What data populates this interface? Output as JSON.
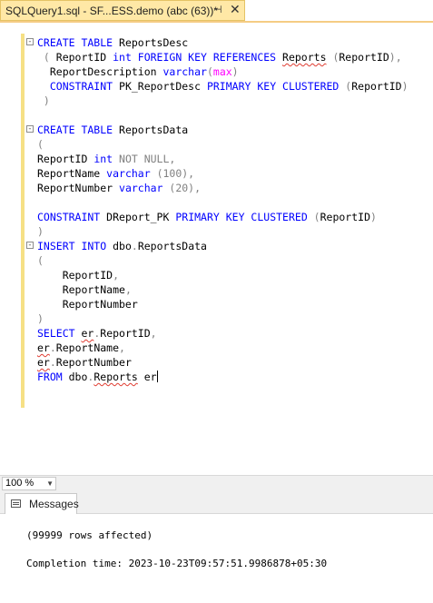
{
  "tab": {
    "title": "SQLQuery1.sql - SF...ESS.demo (abc (63))*",
    "pin_icon": "pin-icon",
    "close_icon": "close-icon"
  },
  "editor": {
    "lines": [
      {
        "fold": "-",
        "tokens": [
          {
            "t": "CREATE TABLE ",
            "c": "kw"
          },
          {
            "t": "ReportsDesc",
            "c": "id"
          }
        ]
      },
      {
        "tokens": [
          {
            "t": " ( ",
            "c": "gray"
          },
          {
            "t": "ReportID ",
            "c": "id"
          },
          {
            "t": "int FOREIGN KEY REFERENCES ",
            "c": "kw"
          },
          {
            "t": "Reports",
            "c": "wavy"
          },
          {
            "t": " ",
            "c": "id"
          },
          {
            "t": "(",
            "c": "gray"
          },
          {
            "t": "ReportID",
            "c": "id"
          },
          {
            "t": "),",
            "c": "gray"
          }
        ]
      },
      {
        "tokens": [
          {
            "t": "  ReportDescription ",
            "c": "id"
          },
          {
            "t": "varchar",
            "c": "kw"
          },
          {
            "t": "(",
            "c": "gray"
          },
          {
            "t": "max",
            "c": "fn"
          },
          {
            "t": ")",
            "c": "gray"
          }
        ]
      },
      {
        "tokens": [
          {
            "t": "  CONSTRAINT ",
            "c": "kw"
          },
          {
            "t": "PK_ReportDesc ",
            "c": "id"
          },
          {
            "t": "PRIMARY KEY CLUSTERED ",
            "c": "kw"
          },
          {
            "t": "(",
            "c": "gray"
          },
          {
            "t": "ReportID",
            "c": "id"
          },
          {
            "t": ")",
            "c": "gray"
          }
        ]
      },
      {
        "tokens": [
          {
            "t": " )",
            "c": "gray"
          }
        ]
      },
      {
        "tokens": []
      },
      {
        "fold": "-",
        "tokens": [
          {
            "t": "CREATE TABLE ",
            "c": "kw"
          },
          {
            "t": "ReportsData",
            "c": "id"
          }
        ]
      },
      {
        "tokens": [
          {
            "t": "(",
            "c": "gray"
          }
        ]
      },
      {
        "tokens": [
          {
            "t": "ReportID ",
            "c": "id"
          },
          {
            "t": "int ",
            "c": "kw"
          },
          {
            "t": "NOT NULL,",
            "c": "gray"
          }
        ]
      },
      {
        "tokens": [
          {
            "t": "ReportName ",
            "c": "id"
          },
          {
            "t": "varchar ",
            "c": "kw"
          },
          {
            "t": "(100),",
            "c": "gray"
          }
        ]
      },
      {
        "tokens": [
          {
            "t": "ReportNumber ",
            "c": "id"
          },
          {
            "t": "varchar ",
            "c": "kw"
          },
          {
            "t": "(20),",
            "c": "gray"
          }
        ]
      },
      {
        "tokens": []
      },
      {
        "tokens": [
          {
            "t": "CONSTRAINT ",
            "c": "kw"
          },
          {
            "t": "DReport_PK ",
            "c": "id"
          },
          {
            "t": "PRIMARY KEY CLUSTERED ",
            "c": "kw"
          },
          {
            "t": "(",
            "c": "gray"
          },
          {
            "t": "ReportID",
            "c": "id"
          },
          {
            "t": ")",
            "c": "gray"
          }
        ]
      },
      {
        "tokens": [
          {
            "t": ")",
            "c": "gray"
          }
        ]
      },
      {
        "fold": "-",
        "tokens": [
          {
            "t": "INSERT INTO ",
            "c": "kw"
          },
          {
            "t": "dbo",
            "c": "id"
          },
          {
            "t": ".",
            "c": "gray"
          },
          {
            "t": "ReportsData",
            "c": "id"
          }
        ]
      },
      {
        "tokens": [
          {
            "t": "(",
            "c": "gray"
          }
        ]
      },
      {
        "tokens": [
          {
            "t": "    ReportID",
            "c": "id"
          },
          {
            "t": ",",
            "c": "gray"
          }
        ]
      },
      {
        "tokens": [
          {
            "t": "    ReportName",
            "c": "id"
          },
          {
            "t": ",",
            "c": "gray"
          }
        ]
      },
      {
        "tokens": [
          {
            "t": "    ReportNumber",
            "c": "id"
          }
        ]
      },
      {
        "tokens": [
          {
            "t": ")",
            "c": "gray"
          }
        ]
      },
      {
        "tokens": [
          {
            "t": "SELECT ",
            "c": "kw"
          },
          {
            "t": "er",
            "c": "wavy"
          },
          {
            "t": ".",
            "c": "gray"
          },
          {
            "t": "ReportID",
            "c": "id"
          },
          {
            "t": ",",
            "c": "gray"
          }
        ]
      },
      {
        "tokens": [
          {
            "t": "er",
            "c": "wavy"
          },
          {
            "t": ".",
            "c": "gray"
          },
          {
            "t": "ReportName",
            "c": "id"
          },
          {
            "t": ",",
            "c": "gray"
          }
        ]
      },
      {
        "tokens": [
          {
            "t": "er",
            "c": "wavy"
          },
          {
            "t": ".",
            "c": "gray"
          },
          {
            "t": "ReportNumber",
            "c": "id"
          }
        ]
      },
      {
        "caret": true,
        "tokens": [
          {
            "t": "FROM ",
            "c": "kw"
          },
          {
            "t": "dbo",
            "c": "id"
          },
          {
            "t": ".",
            "c": "gray"
          },
          {
            "t": "Reports",
            "c": "wavy"
          },
          {
            "t": " er",
            "c": "id"
          }
        ]
      }
    ]
  },
  "zoom": {
    "value": "100 %"
  },
  "results": {
    "tab_label": "Messages",
    "lines": [
      "(99999 rows affected)",
      "Completion time: 2023-10-23T09:57:51.9986878+05:30"
    ]
  },
  "colors": {
    "keyword": "#0000ff",
    "gray": "#808080",
    "function": "#ff00ff",
    "tab_active": "#ffe8a6",
    "change_bar": "#f6e085"
  }
}
